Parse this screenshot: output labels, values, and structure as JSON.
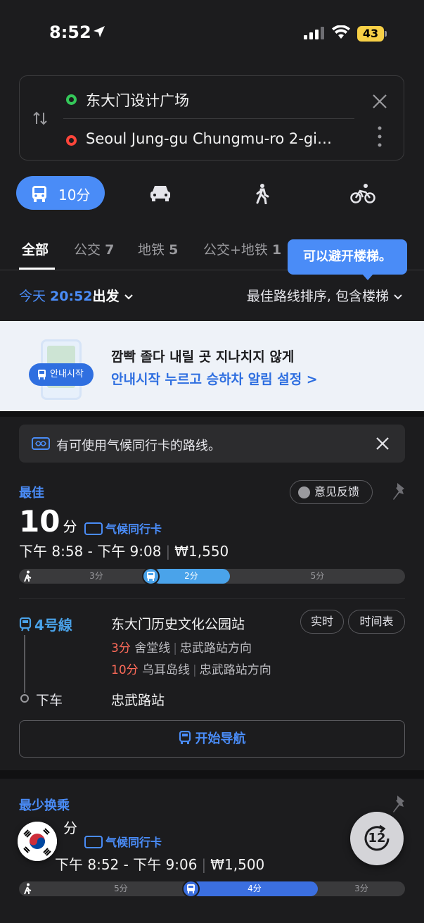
{
  "status_bar": {
    "time": "8:52",
    "battery": "43"
  },
  "route": {
    "origin": "东大门设计广场",
    "destination": "Seoul Jung-gu Chungmu-ro 2-gi…"
  },
  "modes": {
    "transit_label": "10分"
  },
  "tabs": [
    {
      "label": "全部",
      "count": ""
    },
    {
      "label": "公交",
      "count": "7"
    },
    {
      "label": "地铁",
      "count": "5"
    },
    {
      "label": "公交+地铁",
      "count": "1"
    }
  ],
  "tooltip": "可以避开楼梯。",
  "departure": {
    "prefix": "今天 ",
    "time": "20:52",
    "suffix": "出发",
    "chevron": "⌵"
  },
  "sort_label": "最佳路线排序, 包含楼梯",
  "banner": {
    "pill": "안내시작",
    "line1": "깜빡 졸다 내릴 곳 지나치지 않게",
    "line2": "안내시작 누르고 승하차 알림 설정 >"
  },
  "notice": "有可使用气候同行卡的路线。",
  "best_route": {
    "tag": "最佳",
    "feedback": "意见反馈",
    "duration": "10",
    "unit": "分",
    "climate_card": "气候同行卡",
    "times": "下午 8:58 - 下午 9:08",
    "fare": "₩1,550",
    "segments": [
      "3分",
      "2分",
      "5分"
    ],
    "line": "4号線",
    "board_station": "东大门历史文化公园站",
    "arrivals": [
      {
        "min": "3分",
        "train": "舍堂线",
        "dir": "忠武路站方向"
      },
      {
        "min": "10分",
        "train": "乌耳岛线",
        "dir": "忠武路站方向"
      }
    ],
    "realtime": "实时",
    "timetable": "时间表",
    "alight_label": "下车",
    "alight_station": "忠武路站",
    "start_nav": "开始导航"
  },
  "second_route": {
    "tag": "最少换乘",
    "unit": "分",
    "climate_card": "气候同行卡",
    "times": "下午 8:52 - 下午 9:06",
    "fare": "₩1,500",
    "segments": [
      "5分",
      "4分",
      "3分"
    ]
  },
  "fab": {
    "value": "12"
  },
  "colors": {
    "accent": "#4a8cf7",
    "line4": "#4aa3ea",
    "arrival": "#ff6b5a",
    "background": "#1c1c1e"
  }
}
